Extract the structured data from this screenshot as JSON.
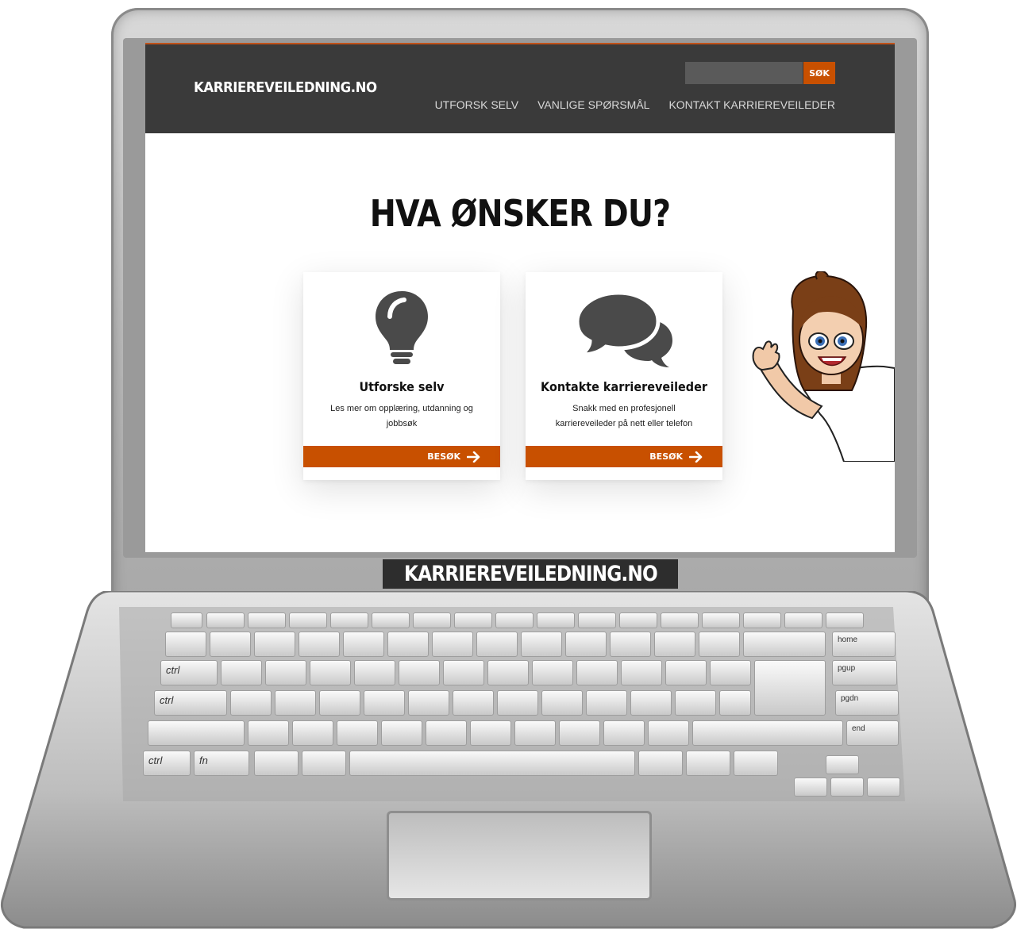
{
  "site": {
    "logo": "KARRIEREVEILEDNING.NO",
    "search": {
      "placeholder": "",
      "button_label": "SØK"
    },
    "nav": [
      "UTFORSK SELV",
      "VANLIGE SPØRSMÅL",
      "KONTAKT KARRIEREVEILEDER"
    ]
  },
  "main": {
    "headline": "HVA ØNSKER DU?",
    "cards": [
      {
        "icon": "lightbulb-icon",
        "title": "Utforske selv",
        "description": "Les mer om opplæring, utdanning og jobbsøk",
        "button": "BESØK"
      },
      {
        "icon": "chat-bubbles-icon",
        "title": "Kontakte karriereveileder",
        "description": "Snakk med en profesjonell karriereveileder på nett eller telefon",
        "button": "BESØK"
      }
    ]
  },
  "caption": "KARRIEREVEILEDNING.NO",
  "keyboard": {
    "labels": [
      "home",
      "pgup",
      "pgdn",
      "end",
      "ctrl",
      "ctrl",
      "ctrl",
      "fn"
    ]
  },
  "colors": {
    "header_bg": "#3a3a3a",
    "accent": "#c85000",
    "screen_bg": "#ffffff"
  }
}
